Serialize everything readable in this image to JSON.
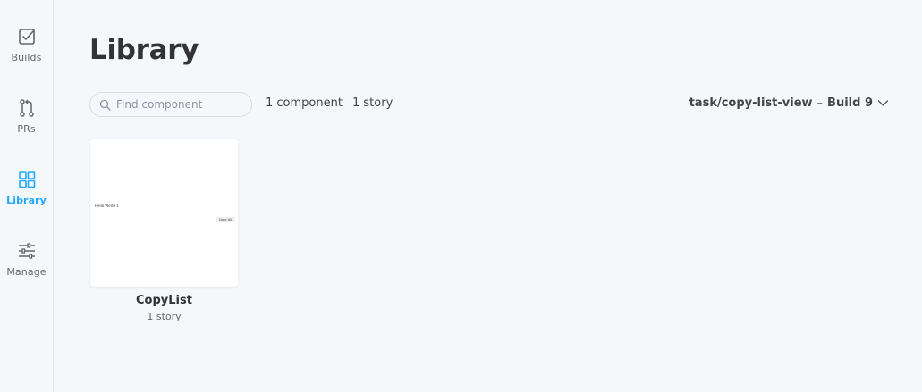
{
  "sidebar": {
    "items": [
      {
        "label": "Builds",
        "icon": "checkbox-icon"
      },
      {
        "label": "PRs",
        "icon": "pull-request-icon"
      },
      {
        "label": "Library",
        "icon": "grid-icon",
        "active": true
      },
      {
        "label": "Manage",
        "icon": "sliders-icon"
      }
    ],
    "accent": "#1ea7fd"
  },
  "header": {
    "title": "Library"
  },
  "toolbar": {
    "search_placeholder": "Find component",
    "search_value": "",
    "component_count": "1 component",
    "story_count": "1 story",
    "branch": "task/copy-list-view",
    "separator": "–",
    "build": "Build 9"
  },
  "components": [
    {
      "name": "CopyList",
      "stories": "1 story",
      "preview_text": "Hello World 1",
      "preview_button": "Copy All"
    }
  ]
}
